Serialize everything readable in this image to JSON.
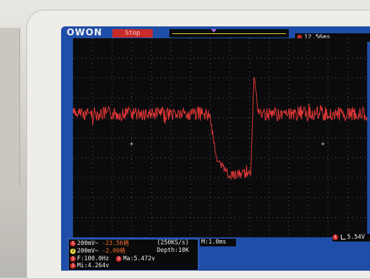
{
  "device": {
    "brand": "OWON",
    "run_status": "Stop",
    "trigger_time_offset": "12.56ms"
  },
  "channels": [
    {
      "id": "1",
      "scale": "200mV~",
      "offset": "-23.56格",
      "color": "#d73030"
    },
    {
      "id": "2",
      "scale": "200mV~",
      "offset": "-2.00格",
      "color": "#e0d640"
    }
  ],
  "acquisition": {
    "sample_rate": "(250KS/s)",
    "depth": "Depth:10K",
    "time_base": "M:1.0ms"
  },
  "measurements": {
    "frequency": "F:100.0Hz",
    "ma": "Ma:5.472v",
    "mi": "Mi:4.264v"
  },
  "trigger_level": "5.54V",
  "waveform": {
    "color": "#e83838",
    "level_high": 0.38,
    "level_low": 0.66,
    "drop_start": 0.465,
    "drop_end": 0.49,
    "recover_start": 0.605,
    "overshoot": 0.18,
    "noise_amp_high": 0.035,
    "noise_amp_low": 0.025
  },
  "colors": {
    "screen_border": "#1f4ea8",
    "plot_bg": "#0b0b0d",
    "grid": "#d0d0d0",
    "stop_badge": "#c92a2a"
  }
}
